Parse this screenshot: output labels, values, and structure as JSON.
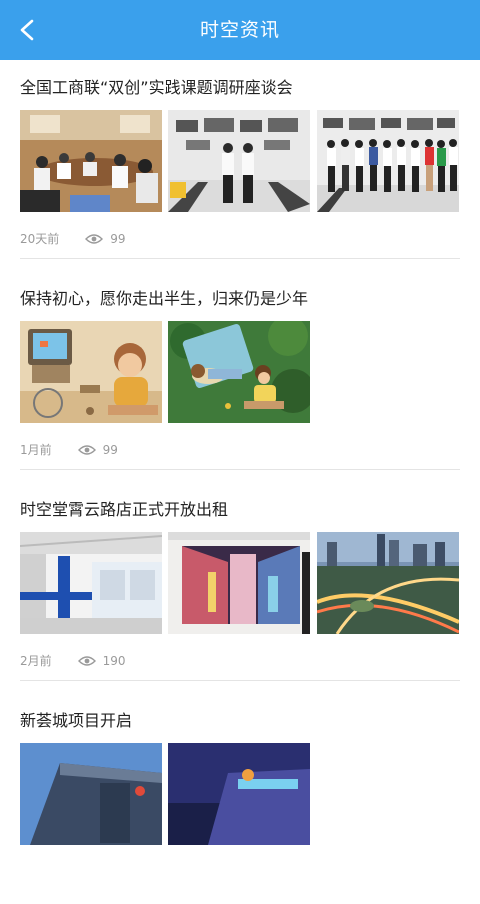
{
  "header": {
    "title": "时空资讯",
    "back_icon": "chevron-left-icon"
  },
  "colors": {
    "header_bg": "#3aa0ec",
    "meta_text": "#9a9a9a",
    "divider": "#e4e4e4"
  },
  "articles": [
    {
      "title": "全国工商联“双创”实践课题调研座谈会",
      "time": "20天前",
      "views": "99",
      "image_count": 3
    },
    {
      "title": "保持初心，愿你走出半生，归来仍是少年",
      "time": "1月前",
      "views": "99",
      "image_count": 2
    },
    {
      "title": "时空堂霄云路店正式开放出租",
      "time": "2月前",
      "views": "190",
      "image_count": 3
    },
    {
      "title": "新荟城项目开启",
      "time": "",
      "views": "",
      "image_count": 2
    }
  ]
}
